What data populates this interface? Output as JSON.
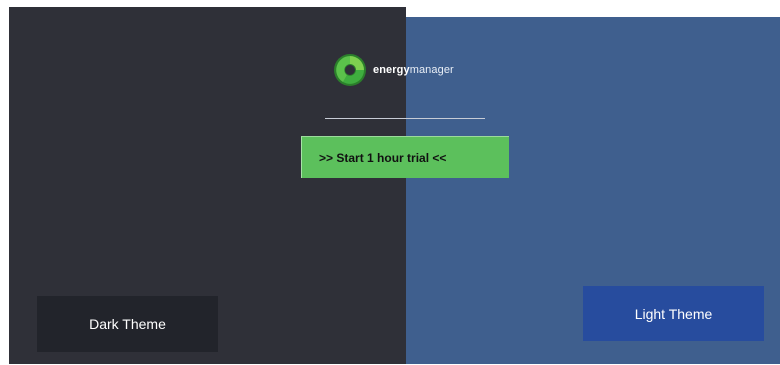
{
  "brand": {
    "name_bold": "energy",
    "name_light": "manager",
    "logo_icon": "energy-swirl-logo",
    "logo_colors": [
      "#2e8b2e",
      "#6cc04a",
      "#3aa23a"
    ]
  },
  "trial": {
    "label": ">> Start 1 hour trial <<",
    "color": "#5cc05c"
  },
  "themes": {
    "dark": {
      "label": "Dark Theme",
      "panel_color": "#2f3038",
      "button_color": "#22242b"
    },
    "light": {
      "label": "Light Theme",
      "panel_color": "#3f5f8e",
      "button_color": "#274c9e"
    }
  }
}
